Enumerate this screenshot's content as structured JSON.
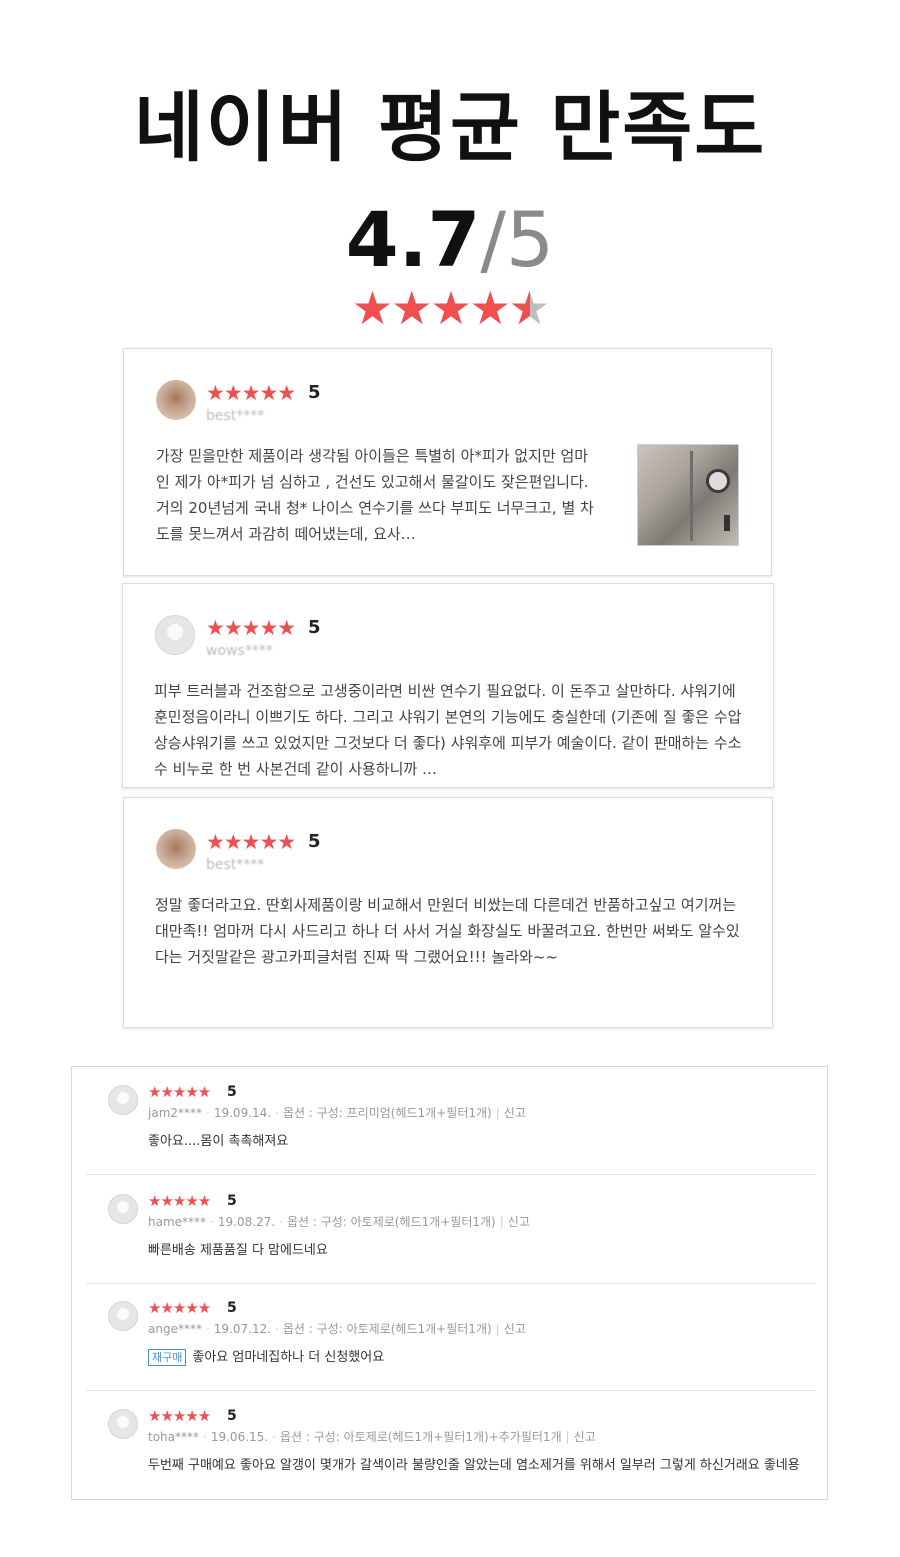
{
  "header": {
    "title": "네이버 평균 만족도",
    "score": "4.7",
    "out_of": "/5",
    "stars": "★★★★"
  },
  "featured_reviews": [
    {
      "stars": "★★★★★",
      "rating": "5",
      "user": "best****",
      "text": "가장 믿을만한 제품이라 생각됨 아이들은 특별히 아*피가 없지만 엄마인 제가 아*피가 넘 심하고 , 건선도 있고해서 물갈이도 잦은편입니다. 거의 20년넘게 국내 청* 나이스 연수기를 쓰다 부피도 너무크고, 별 차도를 못느껴서 과감히 떼어냈는데, 요사…"
    },
    {
      "stars": "★★★★★",
      "rating": "5",
      "user": "wows****",
      "text": "피부 트러블과 건조함으로 고생중이라면 비싼 연수기 필요없다. 이 돈주고 살만하다. 샤워기에 훈민정음이라니 이쁘기도 하다. 그리고 샤워기 본연의 기능에도 충실한데 (기존에 질 좋은 수압상승샤워기를 쓰고 있었지만 그것보다 더 좋다) 샤워후에 피부가 예술이다. 같이 판매하는 수소수 비누로 한 번 사본건데 같이 사용하니까 …"
    },
    {
      "stars": "★★★★★",
      "rating": "5",
      "user": "best****",
      "text": "정말 좋더라고요. 딴회사제품이랑 비교해서 만원더 비쌌는데 다른데건 반품하고싶고 여기꺼는 대만족!! 엄마꺼 다시 사드리고 하나 더 사서 거실 화장실도 바꿀려고요. 한번만 써봐도 알수있다는 거짓말같은 광고카피글처럼 진짜 딱 그랬어요!!! 놀라와~~"
    }
  ],
  "review_list": [
    {
      "stars": "★★★★★",
      "rating": "5",
      "user": "jam2****",
      "date": "19.09.14.",
      "option": "옵션 : 구성: 프리미엄(헤드1개+필터1개)",
      "report": "신고",
      "badge": "",
      "text": "좋아요....몸이 촉촉해져요"
    },
    {
      "stars": "★★★★★",
      "rating": "5",
      "user": "hame****",
      "date": "19.08.27.",
      "option": "옵션 : 구성: 아토제로(헤드1개+필터1개)",
      "report": "신고",
      "badge": "",
      "text": "빠른배송 제품품질 다 맘에드네요"
    },
    {
      "stars": "★★★★★",
      "rating": "5",
      "user": "ange****",
      "date": "19.07.12.",
      "option": "옵션 : 구성: 아토제로(헤드1개+필터1개)",
      "report": "신고",
      "badge": "재구매",
      "text": "좋아요 엄마네집하나 더 신청했어요"
    },
    {
      "stars": "★★★★★",
      "rating": "5",
      "user": "toha****",
      "date": "19.06.15.",
      "option": "옵션 : 구성: 아토제로(헤드1개+필터1개)+추가필터1개",
      "report": "신고",
      "badge": "",
      "text": "두번째 구매예요 좋아요 알갱이 몇개가 갈색이라 불량인줄 알았는데 염소제거를 위해서 일부러 그렇게 하신거래요 좋네용"
    }
  ],
  "colors": {
    "star": "#ef4f4f",
    "badge": "#4a90d9"
  }
}
